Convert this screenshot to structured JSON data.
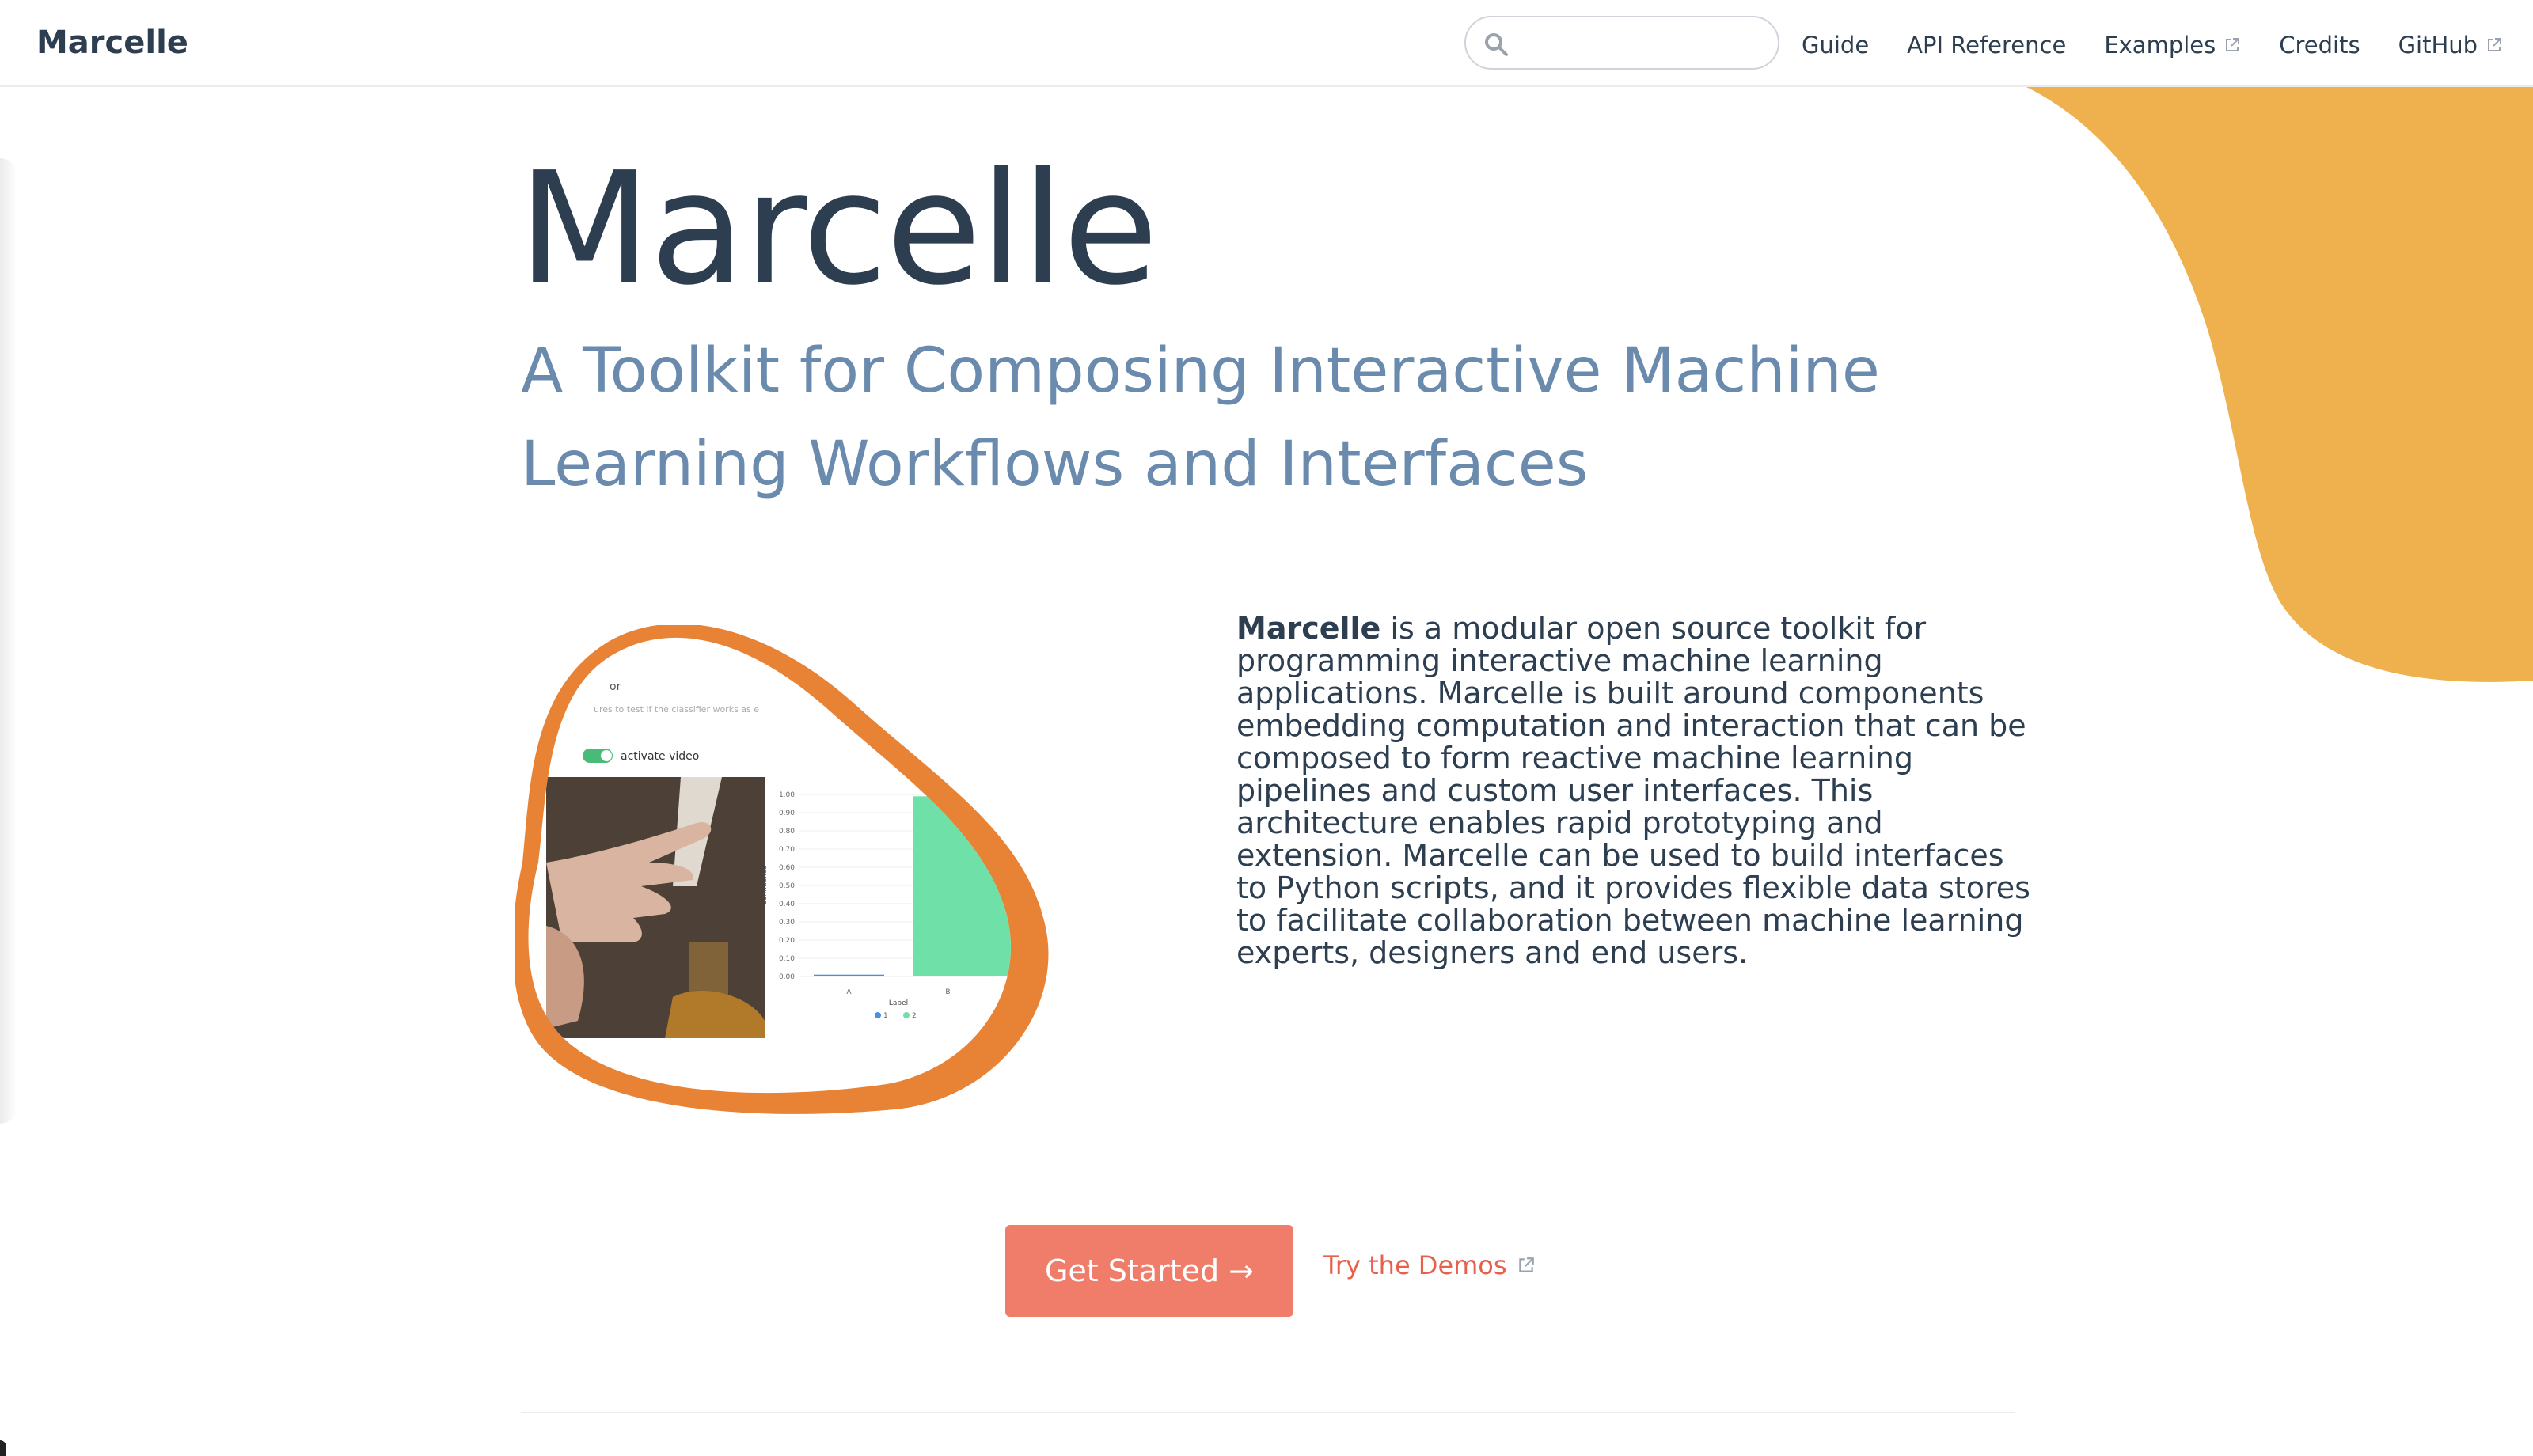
{
  "navbar": {
    "brand": "Marcelle",
    "search": {
      "value": "",
      "placeholder": ""
    },
    "links": [
      {
        "label": "Guide",
        "external": false
      },
      {
        "label": "API Reference",
        "external": false
      },
      {
        "label": "Examples",
        "external": true
      },
      {
        "label": "Credits",
        "external": false
      },
      {
        "label": "GitHub",
        "external": true
      }
    ]
  },
  "hero": {
    "title": "Marcelle",
    "subtitle": "A Toolkit for Composing Interactive Machine Learning Workflows and Interfaces"
  },
  "description": {
    "strong": "Marcelle",
    "text": " is a modular open source toolkit for programming interactive machine learning applications. Marcelle is built around components embedding computation and interaction that can be composed to form reactive machine learning pipelines and custom user interfaces. This architecture enables rapid prototyping and extension. Marcelle can be used to build interfaces to Python scripts, and it provides flexible data stores to facilitate collaboration between machine learning experts, designers and end users."
  },
  "preview": {
    "heading_fragment": "or",
    "caption_fragment": "ures to test if the classifier works as e",
    "toggle_label": "activate video",
    "toggle_on": true,
    "chart": {
      "y_label": "Confidence",
      "x_label": "Label",
      "y_ticks": [
        "1.00",
        "0.90",
        "0.80",
        "0.70",
        "0.60",
        "0.50",
        "0.40",
        "0.30",
        "0.20",
        "0.10",
        "0.00"
      ],
      "categories": [
        "A",
        "B"
      ],
      "values": [
        0.01,
        0.99
      ],
      "legend": [
        "1",
        "2"
      ],
      "colors": [
        "#4a8fe0",
        "#6ee0a8"
      ]
    }
  },
  "actions": {
    "primary_label": "Get Started →",
    "secondary_label": "Try the Demos"
  },
  "colors": {
    "accent": "#ef7d6a",
    "blob": "#efb04e",
    "preview_border": "#e88335",
    "subtitle": "#6a8bad",
    "text": "#2c3e50"
  }
}
